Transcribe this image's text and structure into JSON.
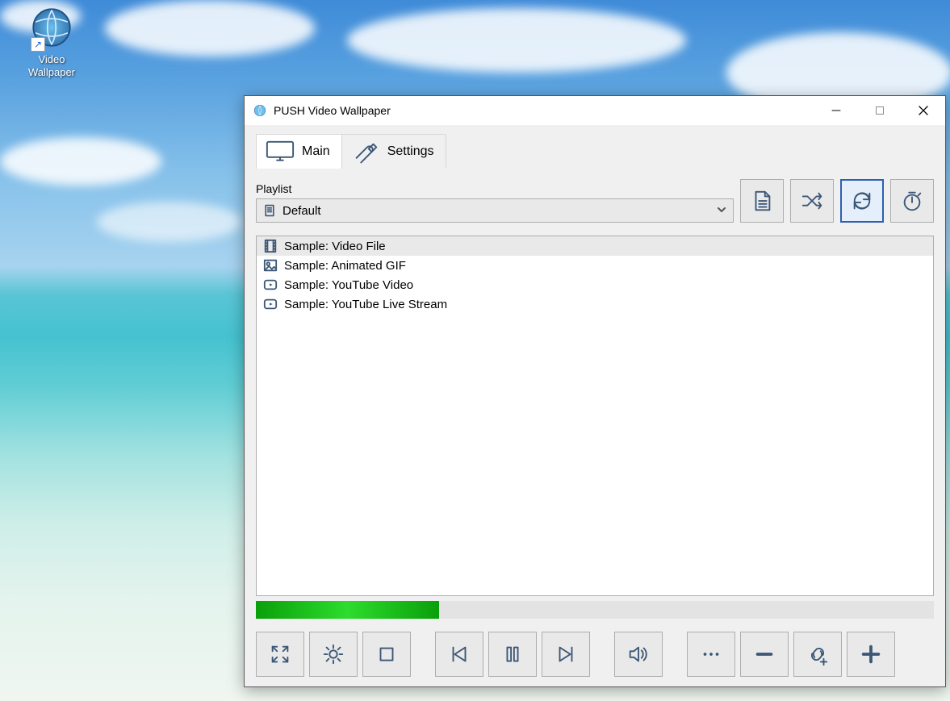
{
  "desktop": {
    "icon_label": "Video Wallpaper"
  },
  "window": {
    "title": "PUSH Video Wallpaper"
  },
  "tabs": {
    "main": "Main",
    "settings": "Settings"
  },
  "playlist": {
    "label": "Playlist",
    "selected": "Default",
    "items": [
      {
        "label": "Sample: Video File",
        "type": "video",
        "selected": true
      },
      {
        "label": "Sample: Animated GIF",
        "type": "image",
        "selected": false
      },
      {
        "label": "Sample: YouTube Video",
        "type": "youtube",
        "selected": false
      },
      {
        "label": "Sample: YouTube Live Stream",
        "type": "youtube",
        "selected": false
      }
    ]
  },
  "progress": {
    "percent": 27
  },
  "colors": {
    "accent": "#3b5676",
    "active_border": "#2f5fb0",
    "progress": "#17c317"
  }
}
